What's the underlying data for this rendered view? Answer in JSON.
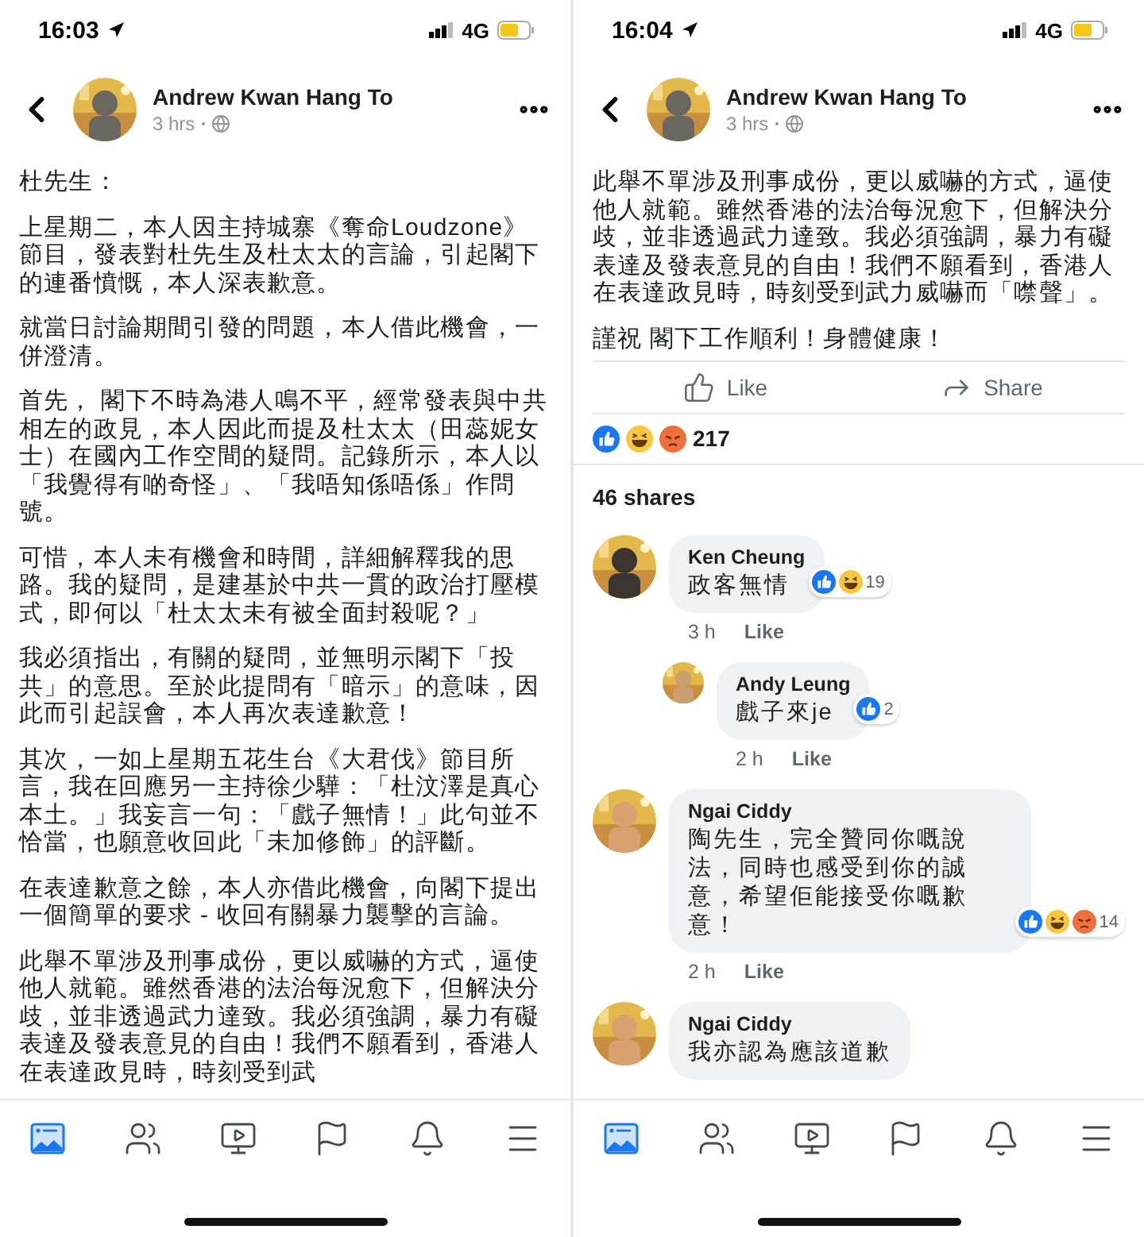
{
  "screens": [
    {
      "status_bar": {
        "time": "16:03",
        "network": "4G"
      },
      "header": {
        "author": "Andrew Kwan Hang To",
        "time": "3 hrs"
      },
      "post": {
        "paragraphs": [
          "杜先生：",
          "上星期二，本人因主持城寨《奪命Loudzone》節目，發表對杜先生及杜太太的言論，引起閣下的連番憤慨，本人深表歉意。",
          "就當日討論期間引發的問題，本人借此機會，一併澄清。",
          "首先， 閣下不時為港人鳴不平，經常發表與中共相左的政見，本人因此而提及杜太太（田蕊妮女士）在國內工作空間的疑問。記錄所示，本人以「我覺得有啲奇怪」、「我唔知係唔係」作問號。",
          "可惜，本人未有機會和時間，詳細解釋我的思路。我的疑問，是建基於中共一貫的政治打壓模式，即何以「杜太太未有被全面封殺呢？」",
          "我必須指出，有關的疑問，並無明示閣下「投共」的意思。至於此提問有「暗示」的意味，因此而引起誤會，本人再次表達歉意！",
          "其次，一如上星期五花生台《大君伐》節目所言，我在回應另一主持徐少驊：「杜汶澤是真心本土。」我妄言一句：「戲子無情！」此句並不恰當，也願意收回此「未加修飾」的評斷。",
          "在表達歉意之餘，本人亦借此機會，向閣下提出一個簡單的要求 - 收回有關暴力襲擊的言論。",
          "此舉不單涉及刑事成份，更以威嚇的方式，逼使他人就範。雖然香港的法治每況愈下，但解決分歧，並非透過武力達致。我必須強調，暴力有礙表達及發表意見的自由！我們不願看到，香港人在表達政見時，時刻受到武"
        ]
      },
      "nav": [
        {
          "kind": "news",
          "selected": true
        },
        {
          "kind": "friends",
          "selected": false
        },
        {
          "kind": "video",
          "selected": false
        },
        {
          "kind": "flag",
          "selected": false
        },
        {
          "kind": "bell",
          "selected": false
        },
        {
          "kind": "menu",
          "selected": false
        }
      ]
    },
    {
      "status_bar": {
        "time": "16:04",
        "network": "4G"
      },
      "header": {
        "author": "Andrew Kwan Hang To",
        "time": "3 hrs"
      },
      "post": {
        "paragraphs": [
          "此舉不單涉及刑事成份，更以威嚇的方式，逼使他人就範。雖然香港的法治每況愈下，但解決分歧，並非透過武力達致。我必須強調，暴力有礙表達及發表意見的自由！我們不願看到，香港人在表達政見時，時刻受到武力威嚇而「噤聲」。",
          "謹祝 閣下工作順利！身體健康！"
        ],
        "actions": [
          {
            "kind": "like",
            "label": "Like"
          },
          {
            "kind": "share",
            "label": "Share"
          }
        ],
        "reactions": {
          "kinds": [
            {
              "kind": "like"
            },
            {
              "kind": "haha"
            },
            {
              "kind": "angry"
            }
          ],
          "count": "217"
        },
        "shares": "46 shares",
        "comments": [
          {
            "name": "Ken Cheung",
            "text": "政客無情",
            "time": "3 h",
            "like": "Like",
            "reactions": {
              "kinds": [
                {
                  "kind": "like"
                },
                {
                  "kind": "haha"
                }
              ],
              "count": "19"
            },
            "children": [
              {
                "name": "Andy Leung",
                "text": "戲子來je",
                "time": "2 h",
                "like": "Like",
                "reactions": {
                  "kinds": [
                    {
                      "kind": "like"
                    }
                  ],
                  "count": "2"
                }
              }
            ]
          },
          {
            "name": "Ngai Ciddy",
            "text": "陶先生，完全贊同你嘅說法，同時也感受到你的誠意，希望佢能接受你嘅歉意！",
            "time": "2 h",
            "like": "Like",
            "reactions": {
              "kinds": [
                {
                  "kind": "like"
                },
                {
                  "kind": "haha"
                },
                {
                  "kind": "angry"
                }
              ],
              "count": "14"
            }
          },
          {
            "name": "Ngai Ciddy",
            "text": "我亦認為應該道歉"
          }
        ]
      },
      "nav": [
        {
          "kind": "news",
          "selected": true
        },
        {
          "kind": "friends",
          "selected": false
        },
        {
          "kind": "video",
          "selected": false
        },
        {
          "kind": "flag",
          "selected": false
        },
        {
          "kind": "bell",
          "selected": false
        },
        {
          "kind": "menu",
          "selected": false
        }
      ]
    }
  ]
}
